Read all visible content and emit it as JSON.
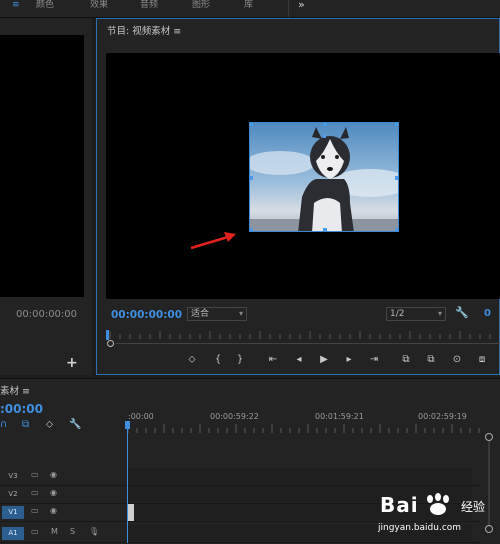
{
  "workspace_tabs": [
    "≡",
    "颜色",
    "效果",
    "音频",
    "图形",
    "库",
    "»"
  ],
  "source_monitor": {
    "timecode": "00:00:00:00",
    "add_label": "+"
  },
  "program_monitor": {
    "title": "节目: 视频素材 ≡",
    "timecode": "00:00:00:00",
    "fit_label": "适合",
    "resolution_label": "1/2",
    "end_timecode": "0"
  },
  "transport_buttons": [
    "⬦",
    "{",
    "}",
    "⇤",
    "◂",
    "▶",
    "▸",
    "⇥",
    "⧉",
    "⧉",
    "⊙",
    "⧈"
  ],
  "timeline": {
    "title": "素材 ≡",
    "timecode": ":00:00",
    "ruler_labels": [
      ":00:00",
      "00:00:59:22",
      "00:01:59:21",
      "00:02:59:19"
    ],
    "tracks": [
      {
        "name": "V3",
        "active": false
      },
      {
        "name": "V2",
        "active": false
      },
      {
        "name": "V1",
        "active": true
      },
      {
        "name": "A1",
        "active": true
      }
    ],
    "audio_track_icons": [
      "M",
      "S"
    ]
  },
  "watermark": {
    "brand": "Bai",
    "suffix": "经验",
    "url": "jingyan.baidu.com"
  },
  "colors": {
    "accent": "#3f8ee0",
    "panel_bg": "#232323",
    "arrow": "#e0221e"
  }
}
